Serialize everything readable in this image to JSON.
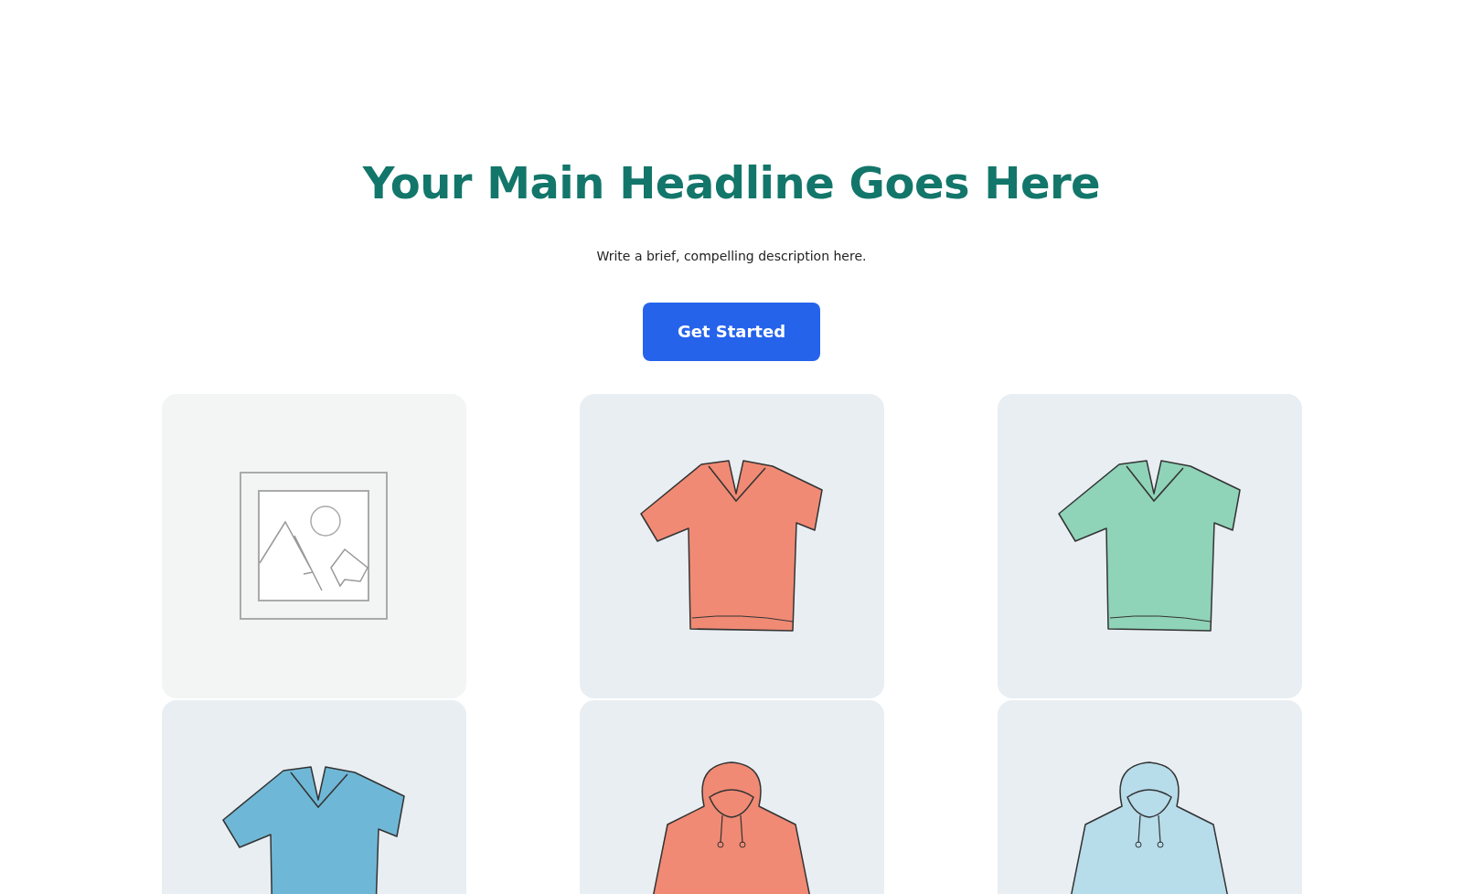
{
  "hero": {
    "headline": "Your Main Headline Goes Here",
    "description": "Write a brief, compelling description here.",
    "button": "Get Started"
  },
  "products": [
    {
      "kind": "placeholder"
    },
    {
      "kind": "tshirt",
      "color": "#f08a74"
    },
    {
      "kind": "tshirt",
      "color": "#8fd3b8"
    },
    {
      "kind": "tshirt",
      "color": "#6fb7d6"
    },
    {
      "kind": "hoodie",
      "color": "#f08a74"
    },
    {
      "kind": "hoodie",
      "color": "#b7dcea"
    }
  ]
}
